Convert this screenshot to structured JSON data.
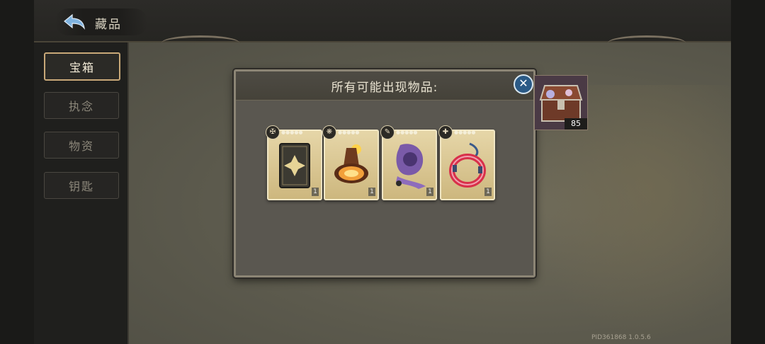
{
  "header": {
    "title": "藏品"
  },
  "sidebar": {
    "items": [
      {
        "label": "宝箱",
        "active": true
      },
      {
        "label": "执念",
        "active": false
      },
      {
        "label": "物资",
        "active": false
      },
      {
        "label": "钥匙",
        "active": false
      }
    ]
  },
  "dialog": {
    "title": "所有可能出现物品:",
    "items": [
      {
        "icon": "card-back-icon",
        "quantity": "1"
      },
      {
        "icon": "glowing-bell-icon",
        "quantity": "1"
      },
      {
        "icon": "purple-hood-icon",
        "quantity": "1"
      },
      {
        "icon": "red-ring-icon",
        "quantity": "1"
      }
    ]
  },
  "chest": {
    "count": "85"
  },
  "footer": {
    "pid": "PID361868  1.0.5.6"
  },
  "colors": {
    "accent": "#c8a878",
    "close": "#2b5a86"
  }
}
